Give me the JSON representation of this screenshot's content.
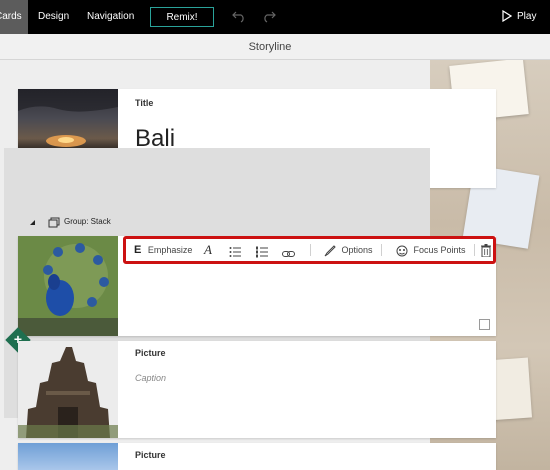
{
  "nav": {
    "tabs": [
      {
        "label": "Cards",
        "active": true
      },
      {
        "label": "Design",
        "active": false
      },
      {
        "label": "Navigation",
        "active": false
      }
    ],
    "remix_label": "Remix!",
    "play_label": "Play"
  },
  "subbar": {
    "title": "Storyline"
  },
  "title_card": {
    "label": "Title",
    "value": "Bali"
  },
  "group": {
    "label": "Group: Stack"
  },
  "toolbar": {
    "emphasize_label": "Emphasize",
    "options_label": "Options",
    "focus_points_label": "Focus Points"
  },
  "picture_card": {
    "label": "Picture",
    "caption_placeholder": "Caption"
  },
  "picture_card_2": {
    "label": "Picture"
  },
  "colors": {
    "toolbar_highlight": "#cc1111",
    "remix_border": "#2aa39a",
    "add_badge": "#1f6f50",
    "topbar": "#000000",
    "active_tab": "#5c5c5c"
  },
  "icons": [
    "undo-icon",
    "redo-icon",
    "play-icon",
    "group-icon",
    "emphasize-icon",
    "font-style-icon",
    "bulleted-list-icon",
    "numbered-list-icon",
    "link-icon",
    "options-icon",
    "focus-points-icon",
    "delete-icon",
    "add-icon"
  ]
}
